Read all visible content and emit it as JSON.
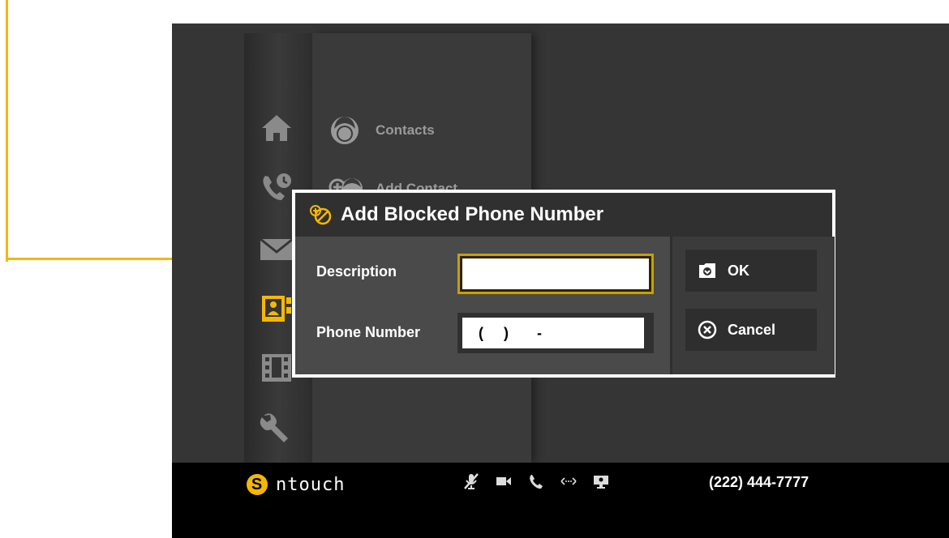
{
  "nav": {
    "icons": [
      "home-icon",
      "call-history-icon",
      "mail-icon",
      "phonebook-icon",
      "video-icon",
      "settings-icon"
    ],
    "active": "phonebook-icon"
  },
  "submenu": {
    "items": [
      {
        "label": "Contacts",
        "icon": "contact-face-icon"
      },
      {
        "label": "Add Contact",
        "icon": "add-contact-icon"
      }
    ]
  },
  "dialog": {
    "title": "Add Blocked Phone Number",
    "title_icon": "block-number-icon",
    "description_label": "Description",
    "description_value": "",
    "phone_label": "Phone Number",
    "phone_value": "(     )       -",
    "ok_label": "OK",
    "cancel_label": "Cancel"
  },
  "bottom_bar": {
    "brand_logo": "S",
    "brand_name": "ntouch",
    "phone_number": "(222) 444-7777",
    "status_icons": [
      "mic-muted-icon",
      "camera-icon",
      "phone-icon",
      "connection-icon",
      "screen-share-icon"
    ]
  },
  "colors": {
    "accent": "#f5b800",
    "background": "#353535",
    "dialog_border": "#ffffff"
  }
}
